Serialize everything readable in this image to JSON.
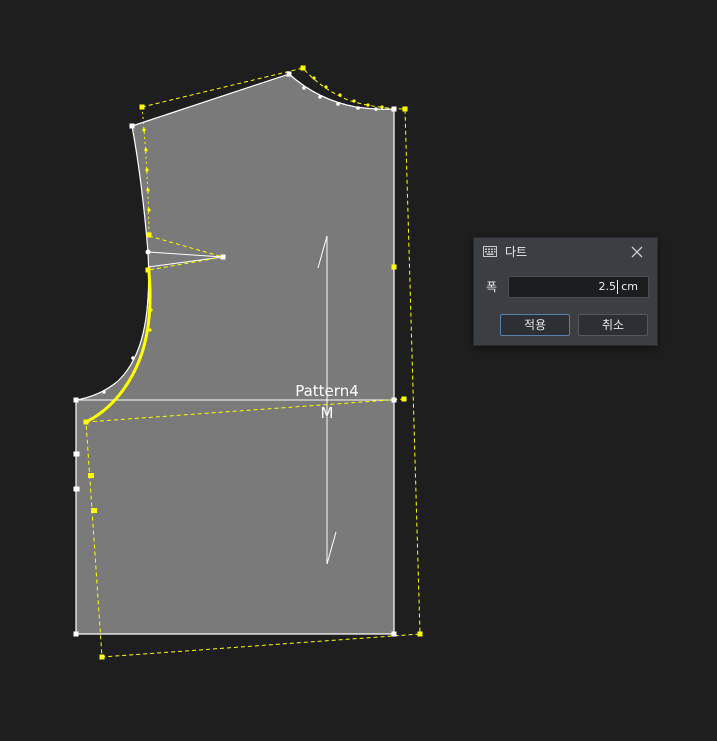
{
  "pattern": {
    "name": "Pattern4",
    "size": "M"
  },
  "colors": {
    "background": "#1e1e1e",
    "piece_fill": "#7a7a7a",
    "outline": "#ffffff",
    "highlight": "#ffff00"
  },
  "dialog": {
    "title": "다트",
    "title_icon": "keyboard-icon",
    "close_icon": "close-icon",
    "field_label": "폭",
    "width_value": "2.5",
    "unit": "cm",
    "apply_label": "적용",
    "cancel_label": "취소"
  }
}
